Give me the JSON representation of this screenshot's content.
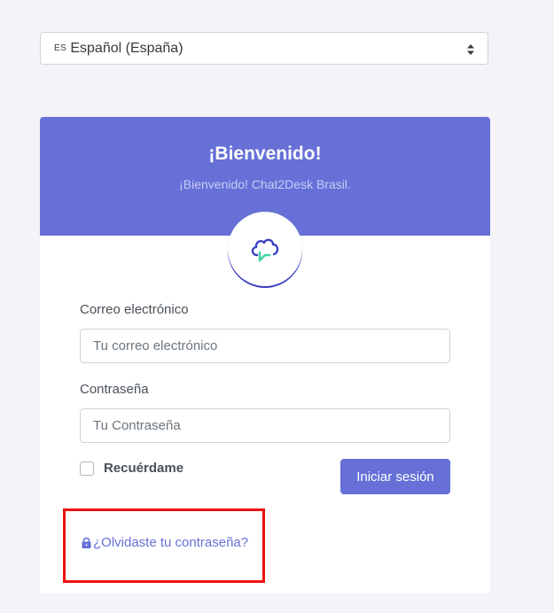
{
  "language_select": {
    "code": "ES",
    "label": "Español (España)"
  },
  "header": {
    "title": "¡Bienvenido!",
    "subtitle": "¡Bienvenido! Chat2Desk Brasil."
  },
  "logo": {
    "icon": "cloud-chat-icon"
  },
  "form": {
    "email_label": "Correo electrónico",
    "email_placeholder": "Tu correo electrónico",
    "password_label": "Contraseña",
    "password_placeholder": "Tu Contraseña",
    "remember_label": "Recuérdame",
    "remember_checked": false,
    "submit_label": "Iniciar sesión",
    "forgot_label": "¿Olvidaste tu contraseña?"
  },
  "colors": {
    "accent": "#6670d7",
    "highlight": "#ee1111",
    "logo_green": "#3ed3a3",
    "logo_blue": "#3a3fc4"
  }
}
